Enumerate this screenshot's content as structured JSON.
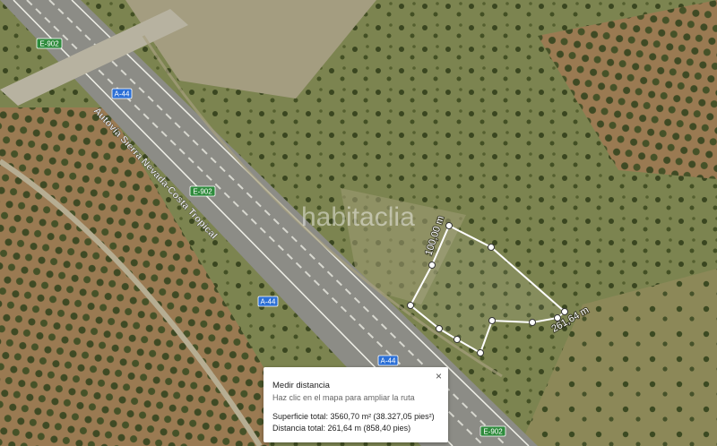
{
  "map": {
    "road_shields": [
      {
        "label": "E-902",
        "color": "#2e8b3c"
      },
      {
        "label": "A-44",
        "color": "#2b6fd6"
      },
      {
        "label": "E-902",
        "color": "#2e8b3c"
      },
      {
        "label": "A-44",
        "color": "#2b6fd6"
      },
      {
        "label": "A-44",
        "color": "#2b6fd6"
      },
      {
        "label": "E-902",
        "color": "#2e8b3c"
      }
    ],
    "road_name": "Autovía Sierra Nevada-Costa Tropical",
    "watermark": "habitaclia",
    "measure_labels": {
      "segment_short": "100,00 m",
      "segment_long": "261,64 m"
    }
  },
  "panel": {
    "title": "Medir distancia",
    "hint": "Haz clic en el mapa para ampliar la ruta",
    "area_label": "Superficie total: 3560,70 m² (38.327,05 pies²)",
    "distance_label": "Distancia total: 261,64 m (858,40 pies)",
    "close_icon": "×"
  }
}
